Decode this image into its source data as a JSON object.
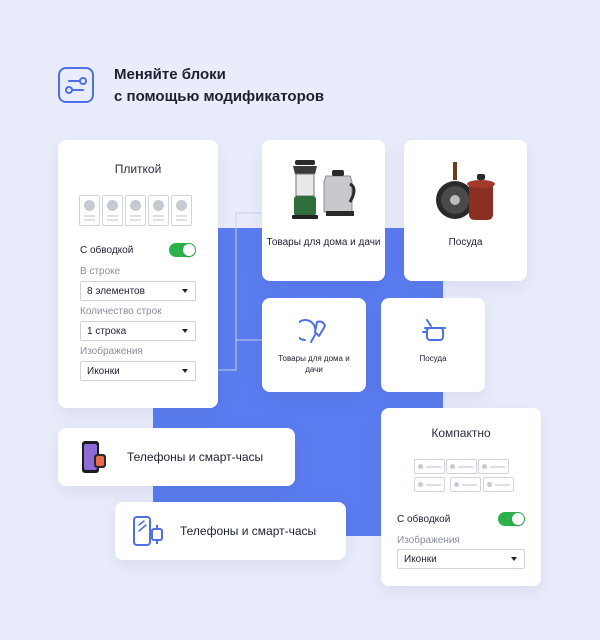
{
  "header": {
    "title_line1": "Меняйте блоки",
    "title_line2": "с помощью модификаторов",
    "icon": "sliders-icon"
  },
  "tiles_panel": {
    "title": "Плиткой",
    "border_label": "С обводкой",
    "border_enabled": true,
    "per_row_label": "В строке",
    "per_row_value": "8 элементов",
    "rows_label": "Количество строк",
    "rows_value": "1 строка",
    "images_label": "Изображения",
    "images_value": "Иконки"
  },
  "cards": {
    "home_garden": "Товары для дома и дачи",
    "dishes": "Посуда",
    "home_garden_icon": "Товары для дома и дачи",
    "dishes_icon": "Посуда",
    "phones_photo": "Телефоны и смарт-часы",
    "phones_icon": "Телефоны и смарт-часы"
  },
  "compact_panel": {
    "title": "Компактно",
    "border_label": "С обводкой",
    "border_enabled": true,
    "images_label": "Изображения",
    "images_value": "Иконки"
  },
  "colors": {
    "accent": "#4e6fe6",
    "blue_block": "#5b7cf0",
    "toggle_on": "#2bb24c",
    "background": "#e9edfb"
  }
}
